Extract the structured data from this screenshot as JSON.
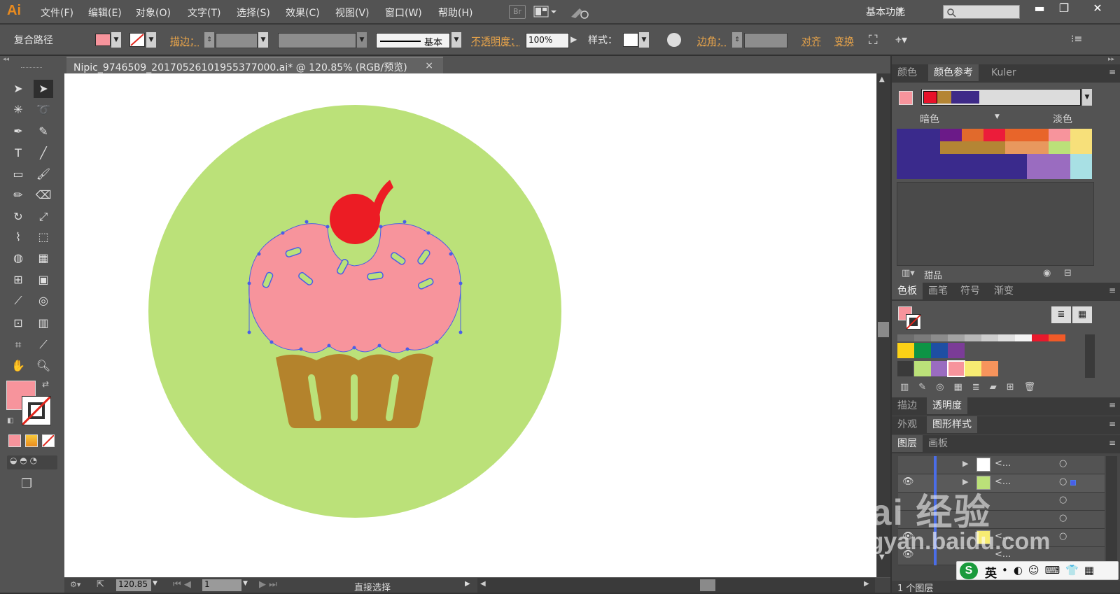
{
  "app": {
    "logo": "Ai",
    "workspace": "基本功能",
    "br_badge": "Br"
  },
  "menu": [
    "文件(F)",
    "编辑(E)",
    "对象(O)",
    "文字(T)",
    "选择(S)",
    "效果(C)",
    "视图(V)",
    "窗口(W)",
    "帮助(H)"
  ],
  "control_bar": {
    "object_type": "复合路径",
    "stroke_label": "描边：",
    "stroke_style": "基本",
    "opacity_label": "不透明度：",
    "opacity_value": "100%",
    "style_label": "样式：",
    "corner_label": "边角：",
    "align_label": "对齐",
    "transform_label": "变换"
  },
  "document": {
    "tab_title": "Nipic_9746509_20170526101955377000.ai* @ 120.85% (RGB/预览)",
    "close": "×"
  },
  "status": {
    "zoom": "120.85",
    "artboard": "1",
    "tool": "直接选择"
  },
  "colors": {
    "fill": "#f7949c",
    "circle_bg": "#bbe179",
    "frosting": "#f7949c",
    "cherry": "#ec1c24",
    "cup": "#b4832c",
    "accent": "#e98b1f",
    "path_blue": "#4a5ee8"
  },
  "color_guide": {
    "tabs": [
      "颜色",
      "颜色参考",
      "Kuler"
    ],
    "dark_label": "暗色",
    "light_label": "淡色",
    "group_name": "甜品",
    "harmony": [
      "#e8122a",
      "#b48534",
      "#3e2a88"
    ]
  },
  "swatches": {
    "tabs": [
      "色板",
      "画笔",
      "符号",
      "渐变"
    ]
  },
  "stroke_panel": {
    "tabs": [
      "描边",
      "透明度"
    ]
  },
  "appearance_panel": {
    "tabs": [
      "外观",
      "图形样式"
    ]
  },
  "layers": {
    "tabs": [
      "图层",
      "画板"
    ],
    "rows": [
      "<...",
      "<...",
      "",
      "",
      "<...",
      "<..."
    ],
    "footer": "1 个图层"
  },
  "watermark": {
    "brand": "Bai  经验",
    "url": "jingyan.baidu.com"
  },
  "ime": {
    "lang": "英"
  }
}
